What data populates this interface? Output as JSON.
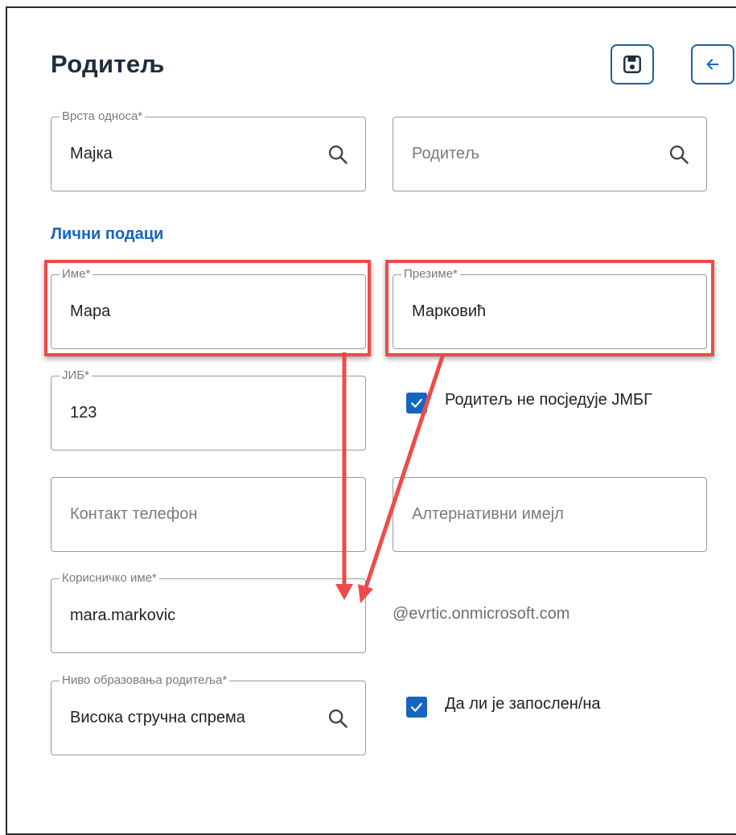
{
  "header": {
    "title": "Родитељ",
    "save_icon": "save-icon",
    "back_icon": "arrow-left-icon"
  },
  "relation": {
    "label": "Врста односа*",
    "value": "Мајка"
  },
  "parent_search": {
    "placeholder": "Родитељ"
  },
  "personal": {
    "section_title": "Лични подаци",
    "first_name": {
      "label": "Име*",
      "value": "Мара"
    },
    "last_name": {
      "label": "Презиме*",
      "value": "Марковић"
    },
    "jib": {
      "label": "ЈИБ*",
      "value": "123"
    },
    "no_jmbg": {
      "label": "Родитељ не посједује ЈМБГ",
      "checked": true
    },
    "phone": {
      "placeholder": "Контакт телефон"
    },
    "alt_email": {
      "placeholder": "Алтернативни имејл"
    },
    "username": {
      "label": "Корисничко име*",
      "value": "mara.markovic"
    },
    "email_domain": "@evrtic.onmicrosoft.com",
    "education": {
      "label": "Ниво образовања родитеља*",
      "value": "Висока стручна спрема"
    },
    "employed": {
      "label": "Да ли је запослен/на",
      "checked": true
    }
  },
  "colors": {
    "accent": "#1565c0",
    "annotation": "#ef4a4a",
    "title": "#1f2d3d"
  }
}
